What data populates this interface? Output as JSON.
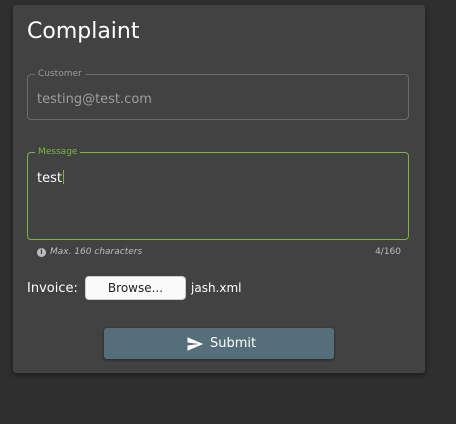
{
  "form": {
    "title": "Complaint",
    "customer": {
      "label": "Customer",
      "value": "testing@test.com"
    },
    "message": {
      "label": "Message",
      "value": "test",
      "hint": "Max. 160 characters",
      "counter": "4/160"
    },
    "invoice": {
      "label": "Invoice:",
      "browse_label": "Browse...",
      "file_name": "jash.xml"
    },
    "submit_label": "Submit"
  },
  "colors": {
    "accent_focus": "#7cb342",
    "submit_background": "#546e7a",
    "card_background": "#424242",
    "page_background": "#2f2f2f"
  },
  "icons": {
    "hint_icon": "info-icon",
    "submit_icon": "send-icon"
  }
}
